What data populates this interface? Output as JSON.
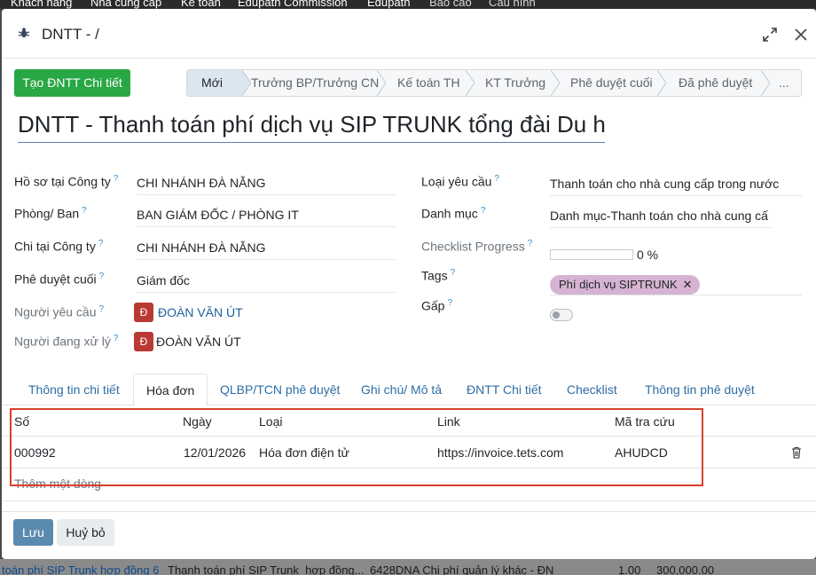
{
  "backdrop": {
    "top_nav": [
      "Khách hàng",
      "Nhà cung cấp",
      "Kế toán",
      "Edupath Commission",
      "Edupath",
      "Báo cáo",
      "Cấu hình"
    ],
    "bottom_row": {
      "link": "toán phí SIP Trunk hợp đồng 6",
      "description": "Thanh toán phí SIP Trunk_hợp đồng...",
      "category": "6428DNA Chi phí quản lý khác - ĐN",
      "qty": "1.00",
      "amount": "300,000.00"
    }
  },
  "modal": {
    "title": "DNTT - /",
    "create_button": "Tạo ĐNTT Chi tiết",
    "stages": [
      "Mới",
      "Trưởng BP/Trưởng CN",
      "Kế toán TH",
      "KT Trưởng",
      "Phê duyệt cuối",
      "Đã phê duyệt",
      "..."
    ],
    "active_stage": "Mới",
    "record_title": "DNTT - Thanh toán phí dịch vụ SIP TRUNK tổng đài Du học",
    "left_fields": {
      "company_label": "Hồ sơ tại Công ty",
      "company_value": "CHI NHÁNH ĐÀ NẴNG",
      "department_label": "Phòng/ Ban",
      "department_value": "BAN GIÁM ĐỐC / PHÒNG IT",
      "spend_company_label": "Chi tại Công ty",
      "spend_company_value": "CHI NHÁNH ĐÀ NẴNG",
      "final_approver_label": "Phê duyệt cuối",
      "final_approver_value": "Giám đốc",
      "requester_label": "Người yêu cầu",
      "requester_initial": "Đ",
      "requester_name": "ĐOÀN VĂN ÚT",
      "handler_label": "Người đang xử lý",
      "handler_initial": "Đ",
      "handler_name": "ĐOÀN VĂN ÚT"
    },
    "right_fields": {
      "request_type_label": "Loại yêu cầu",
      "request_type_value": "Thanh toán cho nhà cung cấp trong nước",
      "category_label": "Danh mục",
      "category_value": "Danh mục-Thanh toán cho nhà cung cấ",
      "checklist_label": "Checklist Progress",
      "checklist_progress": 0,
      "checklist_text": "0 %",
      "tags_label": "Tags",
      "tag_value": "Phí dịch vụ SIPTRUNK",
      "tag_remove": "✕",
      "urgent_label": "Gấp",
      "urgent_on": false
    },
    "help_mark": "?",
    "tabs": [
      "Thông tin chi tiết",
      "Hóa đơn",
      "QLBP/TCN phê duyệt",
      "Ghi chú/ Mô tả",
      "ĐNTT Chi tiết",
      "Checklist",
      "Thông tin phê duyệt"
    ],
    "active_tab": "Hóa đơn",
    "invoice_table": {
      "columns": [
        "Số",
        "Ngày",
        "Loại",
        "Link",
        "Mã tra cứu"
      ],
      "rows": [
        {
          "number": "000992",
          "date": "12/01/2026",
          "type": "Hóa đơn điện tử",
          "link": "https://invoice.tets.com",
          "lookup_code": "AHUDCD"
        }
      ],
      "add_line": "Thêm một dòng"
    },
    "footer": {
      "save": "Lưu",
      "discard": "Huỷ bỏ"
    }
  },
  "colors": {
    "primary_green": "#28a745",
    "save_blue": "#5b8aaf",
    "highlight_red": "#d9402e",
    "tag_purple": "#d6b4d1",
    "avatar_red": "#b93a32"
  }
}
